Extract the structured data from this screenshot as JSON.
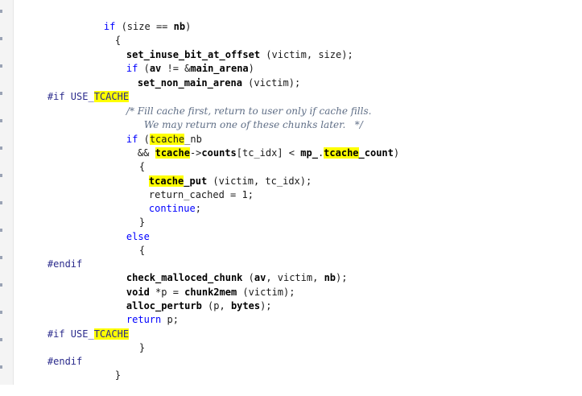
{
  "code": {
    "l1": {
      "kw_if": "if",
      "t1": " (size ",
      "op": "==",
      "t2": " ",
      "b1": "nb",
      "t3": ")"
    },
    "l2": {
      "brace": "{"
    },
    "l3": {
      "b1": "set_inuse_bit_at_offset",
      "t1": " (victim, size);"
    },
    "l4": {
      "kw_if": "if",
      "t1": " (",
      "b1": "av",
      "t2": " != &",
      "b2": "main_arena",
      "t3": ")"
    },
    "l5": {
      "b1": "set_non_main_arena",
      "t1": " (victim);"
    },
    "l6": {
      "pp": "#if USE_",
      "hl": "TCACHE"
    },
    "l7": {
      "cm": "/* Fill cache first, return to user only if cache fills."
    },
    "l8": {
      "cm": "We may return one of these chunks later.   */"
    },
    "l9": {
      "kw_if": "if",
      "t1": " (",
      "hl": "tcache",
      "t2": "_nb"
    },
    "l10": {
      "t1": "&& ",
      "hl": "tcache",
      "t2": "->",
      "b1": "counts",
      "t3": "[tc_idx] < ",
      "b2": "mp_",
      "t4": ".",
      "hl2": "tcache",
      "b3": "_count",
      "t5": ")"
    },
    "l11": {
      "brace": "{"
    },
    "l12": {
      "hl": "tcache",
      "b1": "_put",
      "t1": " (victim, tc_idx);"
    },
    "l13": {
      "t1": "return_cached = 1;"
    },
    "l14": {
      "kw": "continue",
      "t1": ";"
    },
    "l15": {
      "brace": "}"
    },
    "l16": {
      "kw": "else"
    },
    "l17": {
      "brace": "{"
    },
    "l18": {
      "pp": "#endif"
    },
    "l19": {
      "b1": "check_malloced_chunk",
      "t1": " (",
      "b2": "av",
      "t2": ", victim, ",
      "b3": "nb",
      "t3": ");"
    },
    "l20": {
      "b1": "void",
      "t1": " *p = ",
      "b2": "chunk2mem",
      "t2": " (victim);"
    },
    "l21": {
      "b1": "alloc_perturb",
      "t1": " (p, ",
      "b2": "bytes",
      "t2": ");"
    },
    "l22": {
      "kw": "return",
      "t1": " p;"
    },
    "l23": {
      "pp": "#if USE_",
      "hl": "TCACHE"
    },
    "l24": {
      "brace": "}"
    },
    "l25": {
      "pp": "#endif"
    },
    "l26": {
      "brace": "}"
    }
  },
  "colors": {
    "keyword": "#0000ff",
    "highlight": "#ffff00",
    "comment": "#5f6e86"
  }
}
